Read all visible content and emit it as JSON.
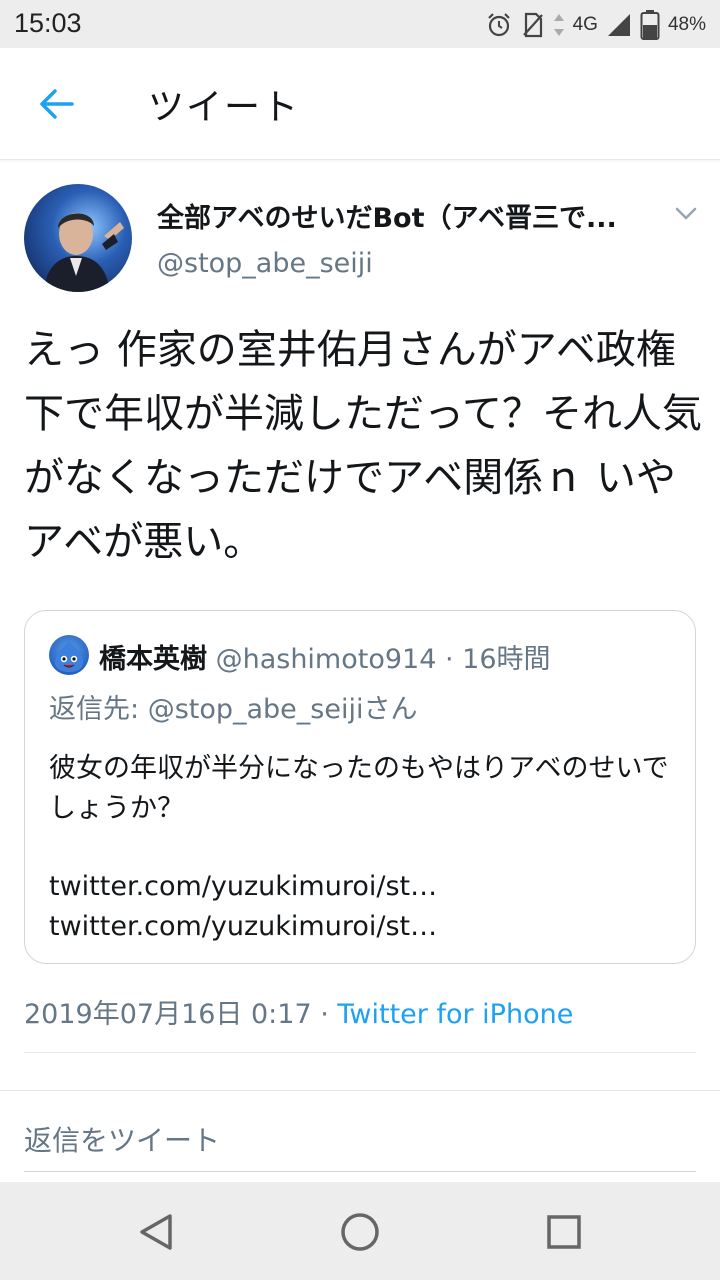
{
  "status_bar": {
    "time": "15:03",
    "network": "4G",
    "battery": "48%",
    "icons": [
      "alarm-icon",
      "no-sim-icon",
      "data-arrows-icon",
      "signal-icon",
      "battery-icon"
    ]
  },
  "header": {
    "title": "ツイート",
    "back_icon": "arrow-left-icon"
  },
  "tweet": {
    "author": {
      "display_name": "全部アベのせいだBot（アベ晋三で...",
      "handle": "@stop_abe_seiji"
    },
    "text": "えっ 作家の室井佑月さんがアベ政権下で年収が半減しただって？それ人気がなくなっただけでアベ関係ｎ いやアベが悪い。",
    "quoted": {
      "name": "橋本英樹",
      "handle": "@hashimoto914",
      "time": "16時間",
      "reply_prefix": "返信先: ",
      "reply_handle": "@stop_abe_seiji",
      "reply_suffix": "さん",
      "text": "彼女の年収が半分になったのもやはりアベのせいでしょうか？",
      "links": "twitter.com/yuzukimuroi/st… twitter.com/yuzukimuroi/st…"
    },
    "timestamp": "2019年07月16日 0:17",
    "separator": " · ",
    "client": "Twitter for iPhone"
  },
  "reply": {
    "placeholder": "返信をツイート"
  },
  "colors": {
    "accent": "#1da1f2",
    "secondary_text": "#657786",
    "primary_text": "#14171a",
    "border": "#e1e8ed"
  }
}
